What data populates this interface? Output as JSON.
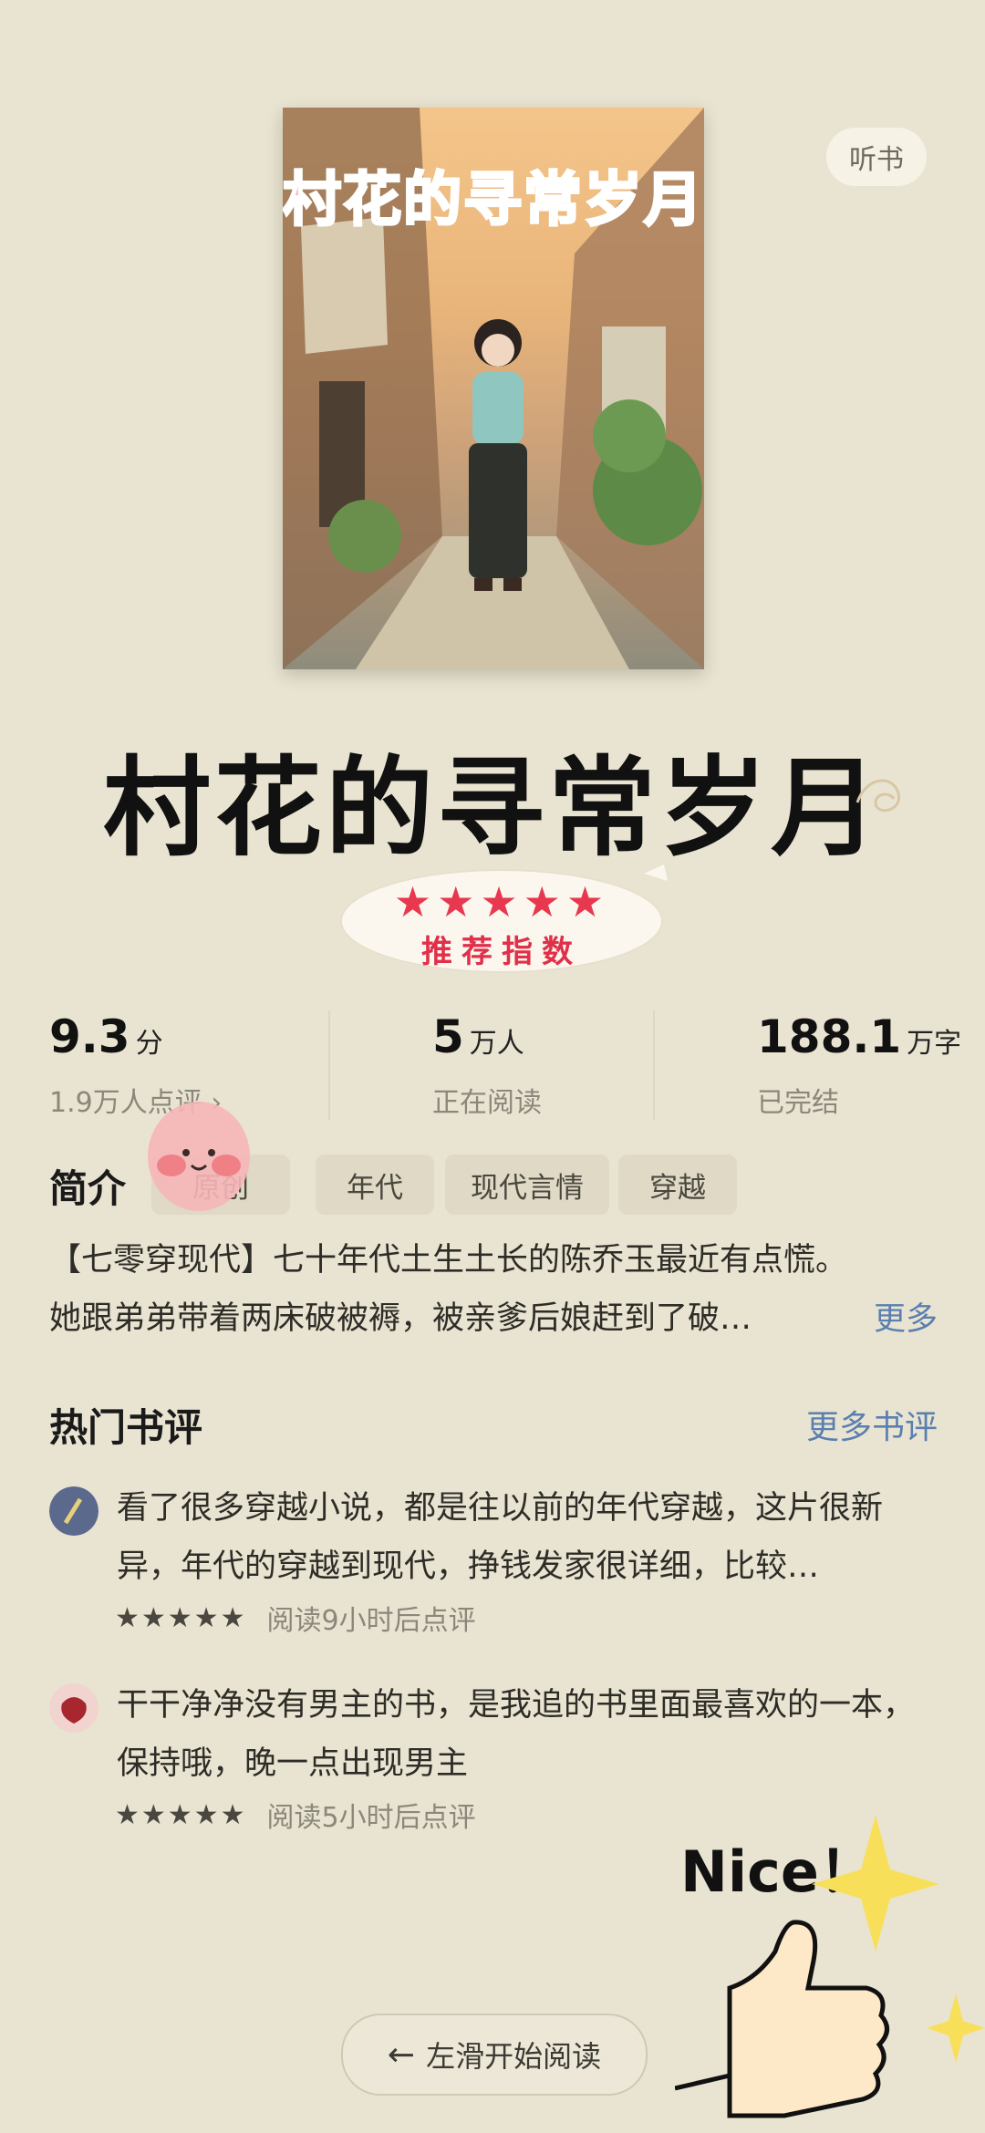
{
  "header": {
    "listen_label": "听书"
  },
  "cover": {
    "title_text": "村花的寻常岁月"
  },
  "book": {
    "title": "村花的寻常岁月",
    "stamp_stars": "★★★★★",
    "stamp_text": "推荐指数"
  },
  "stats": [
    {
      "value": "9.3",
      "unit": "分",
      "sub": "1.9万人点评 ›"
    },
    {
      "value": "5",
      "unit": "万人",
      "sub": "正在阅读"
    },
    {
      "value": "188.1",
      "unit": "万字",
      "sub": "已完结"
    }
  ],
  "intro": {
    "label": "简介",
    "tags": [
      "原创",
      "年代",
      "现代言情",
      "穿越"
    ],
    "desc_line1": "【七零穿现代】七十年代土生土长的陈乔玉最近有点慌。",
    "desc_line2": "她跟弟弟带着两床破被褥，被亲爹后娘赶到了破…",
    "more_label": "更多"
  },
  "reviews": {
    "title": "热门书评",
    "more_label": "更多书评",
    "items": [
      {
        "text": "看了很多穿越小说，都是往以前的年代穿越，这片很新异，年代的穿越到现代，挣钱发家很详细，比较…",
        "stars": "★★★★★",
        "meta": "阅读9小时后点评"
      },
      {
        "text": "干干净净没有男主的书，是我追的书里面最喜欢的一本，保持哦，晚一点出现男主",
        "stars": "★★★★★",
        "meta": "阅读5小时后点评"
      }
    ]
  },
  "footer": {
    "start_label": "左滑开始阅读",
    "arrow": "←"
  },
  "stickers": {
    "nice": "Nice！"
  }
}
